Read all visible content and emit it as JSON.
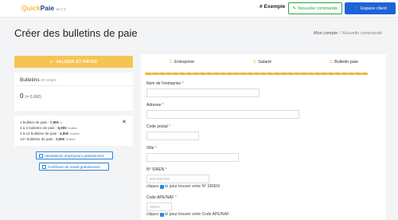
{
  "navbar": {
    "logo_quick": "Quick",
    "logo_paie": "Paie",
    "logo_version": "v2.7.1",
    "example_label": "Exemple",
    "new_order_label": "Nouvelle commande",
    "client_space_label": "Espace client"
  },
  "page": {
    "title": "Créer des bulletins de paie",
    "breadcrumb": [
      "Mon compte",
      "Nouvelle commande"
    ]
  },
  "left": {
    "validate_label": "VALIDER ET PAYER",
    "bulletins_title": "Bulletins",
    "bulletins_sub": "en cours",
    "count": "0",
    "total": "(= 0,00€)",
    "pricing": [
      {
        "text": "1 bulletin de paie : ",
        "price": "7,90€",
        "unit": "/u"
      },
      {
        "text": "2 à 3 bulletins de paie : ",
        "price": "6,90€",
        "unit": "/bulletin"
      },
      {
        "text": "4 à 12 bulletins de paie : ",
        "price": "4,90€",
        "unit": "/bulletin"
      },
      {
        "text": "13+ bulletins de paie : ",
        "price": "2,90€",
        "unit": "/bulletin"
      }
    ],
    "close_symbol": "×",
    "link1": "Attestations employeurs gratuitement",
    "link2": "Certificats de travail gratuitement"
  },
  "form": {
    "tabs": [
      {
        "num": "1.",
        "label": "Entreprise"
      },
      {
        "num": "2.",
        "label": "Salarié"
      },
      {
        "num": "3.",
        "label": "Bulletin paie"
      }
    ],
    "company_name_label": "Nom de l'entreprise",
    "address_label": "Adresse",
    "postal_label": "Code postal",
    "city_label": "Ville",
    "siren_label": "N° SIREN",
    "siren_placeholder": "000 000 000",
    "siren_help_pre": "cliquez",
    "siren_help_post": "ici pour trouver votre N° SIREN",
    "ape_label": "Code APE/NAF",
    "ape_placeholder": "0000A",
    "ape_help_pre": "cliquez",
    "ape_help_post": "ici pour trouver votre Code APE/NAF",
    "required_mark": "*"
  },
  "colors": {
    "accent_yellow": "#f6c453",
    "brand_blue": "#1f63d6",
    "green": "#28a745"
  }
}
